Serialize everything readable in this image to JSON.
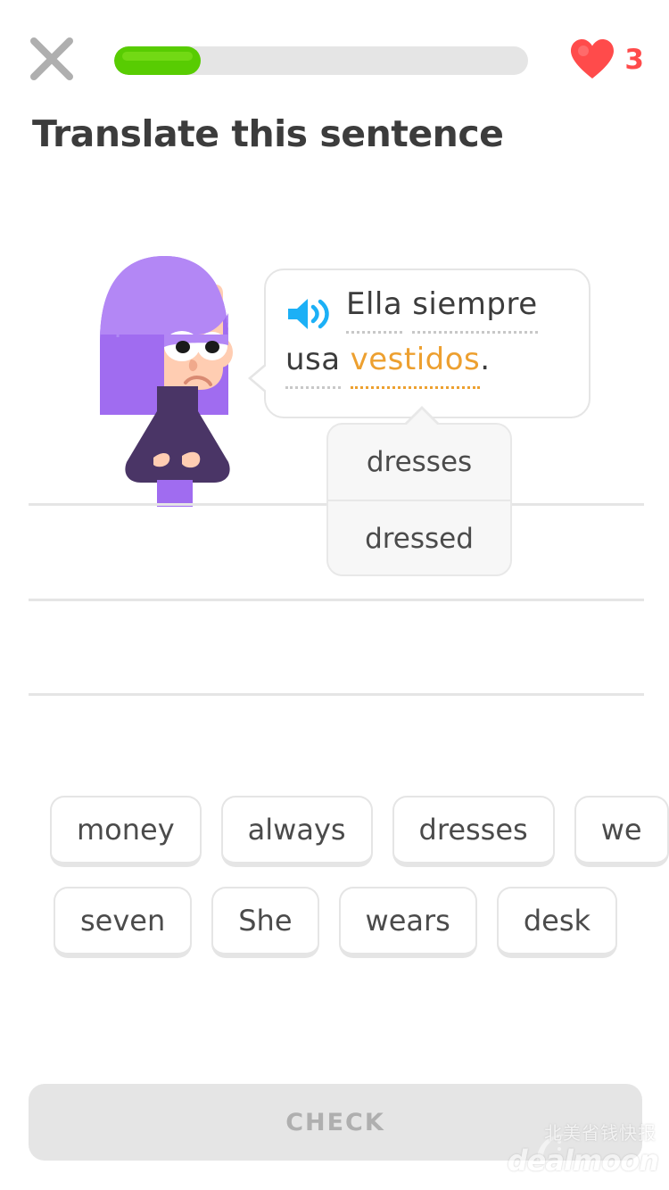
{
  "header": {
    "close_icon": "close-icon",
    "progress": {
      "percent": 21,
      "fill_color": "#58cc02",
      "track_color": "#e5e5e5"
    },
    "hearts": {
      "icon": "heart-icon",
      "count": "3",
      "color": "#ff4b4b"
    }
  },
  "title": "Translate this sentence",
  "character": {
    "name": "lily-character",
    "hair_color": "#b387f5",
    "hair_shade": "#a06cf0",
    "skin_color": "#ffcdb2",
    "shirt_color": "#4a3566",
    "body_color": "#a06cf0"
  },
  "prompt": {
    "speaker_icon": "speaker-icon",
    "speaker_color": "#1cb0f6",
    "hint_color": "#eda030",
    "line1": [
      {
        "text": "Ella",
        "style": "dotted"
      },
      {
        "text": "siempre",
        "style": "dotted"
      }
    ],
    "line2": [
      {
        "text": "usa",
        "style": "dotted"
      },
      {
        "text": "vestidos",
        "style": "hint"
      },
      {
        "text": ".",
        "style": "plain"
      }
    ]
  },
  "hint_popup": {
    "options": [
      "dresses",
      "dressed"
    ]
  },
  "answer_lines": 3,
  "word_bank": {
    "rows": [
      [
        "money",
        "always",
        "dresses",
        "we"
      ],
      [
        "seven",
        "She",
        "wears",
        "desk"
      ]
    ]
  },
  "check_button": {
    "label": "CHECK",
    "enabled": false
  },
  "watermark": {
    "cn_text": "北美省钱快报",
    "brand": "dealmoon"
  }
}
